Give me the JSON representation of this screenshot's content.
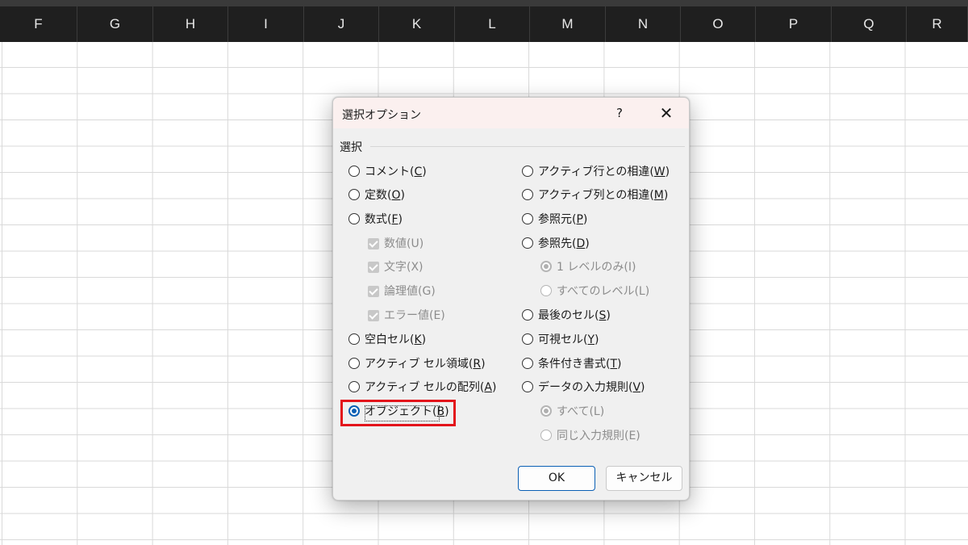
{
  "column_headers": [
    "F",
    "G",
    "H",
    "I",
    "J",
    "K",
    "L",
    "M",
    "N",
    "O",
    "P",
    "Q",
    "R"
  ],
  "dialog": {
    "title": "選択オプション",
    "help": "?",
    "close": "✕",
    "group_label": "選択",
    "left_options": [
      {
        "text": "コメント(",
        "key": "C",
        "tail": ")"
      },
      {
        "text": "定数(",
        "key": "O",
        "tail": ")"
      },
      {
        "text": "数式(",
        "key": "F",
        "tail": ")"
      }
    ],
    "formula_sub": [
      "数値(U)",
      "文字(X)",
      "論理値(G)",
      "エラー値(E)"
    ],
    "left_options_2": [
      {
        "text": "空白セル(",
        "key": "K",
        "tail": ")"
      },
      {
        "text": "アクティブ セル領域(",
        "key": "R",
        "tail": ")"
      },
      {
        "text": "アクティブ セルの配列(",
        "key": "A",
        "tail": ")"
      },
      {
        "text": "オブジェクト(",
        "key": "B",
        "tail": ")"
      }
    ],
    "right_options": [
      {
        "text": "アクティブ行との相違(",
        "key": "W",
        "tail": ")"
      },
      {
        "text": "アクティブ列との相違(",
        "key": "M",
        "tail": ")"
      },
      {
        "text": "参照元(",
        "key": "P",
        "tail": ")"
      },
      {
        "text": "参照先(",
        "key": "D",
        "tail": ")"
      }
    ],
    "dependents_sub": [
      "1 レベルのみ(I)",
      "すべてのレベル(L)"
    ],
    "right_options_2": [
      {
        "text": "最後のセル(",
        "key": "S",
        "tail": ")"
      },
      {
        "text": "可視セル(",
        "key": "Y",
        "tail": ")"
      },
      {
        "text": "条件付き書式(",
        "key": "T",
        "tail": ")"
      },
      {
        "text": "データの入力規則(",
        "key": "V",
        "tail": ")"
      }
    ],
    "validation_sub": [
      "すべて(L)",
      "同じ入力規則(E)"
    ],
    "selected_option": "オブジェクト(B)",
    "ok_label": "OK",
    "cancel_label": "キャンセル"
  },
  "colors": {
    "accent": "#0a5fb4",
    "highlight": "#e3141b",
    "header_bg": "#1f1f1f"
  }
}
